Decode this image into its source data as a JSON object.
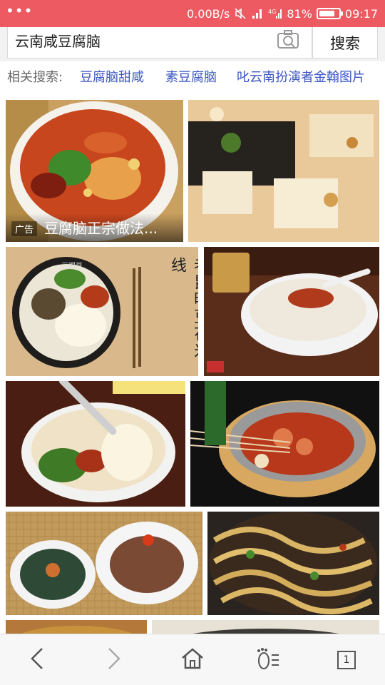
{
  "status_bar": {
    "dots": "•••",
    "net_speed": "0.00B/s",
    "battery_text": "81%",
    "battery_level": 0.81,
    "time": "09:17",
    "icons": [
      "mute-icon",
      "signal-icon",
      "4g-signal-icon",
      "battery-icon"
    ]
  },
  "search": {
    "query": "云南咸豆腐脑",
    "button_label": "搜索",
    "camera_icon": "camera-icon"
  },
  "related": {
    "label": "相关搜索:",
    "items": [
      "豆腐脑甜咸",
      "素豆腐脑",
      "叱云南扮演者金翰图片"
    ]
  },
  "results": {
    "ad": {
      "badge": "广告",
      "title": "豆腐脑正宗做法..."
    },
    "tile_text": {
      "sign": "老昆明豆花米线",
      "bowl_label": "三眼豆"
    }
  },
  "bottom_nav": {
    "tab_count": "1",
    "icons": [
      "back-arrow-icon",
      "forward-arrow-icon",
      "home-icon",
      "menu-icon",
      "tabs-icon"
    ]
  },
  "colors": {
    "status_bar": "#ee5a62",
    "link": "#3b56c4",
    "label": "#666666"
  }
}
